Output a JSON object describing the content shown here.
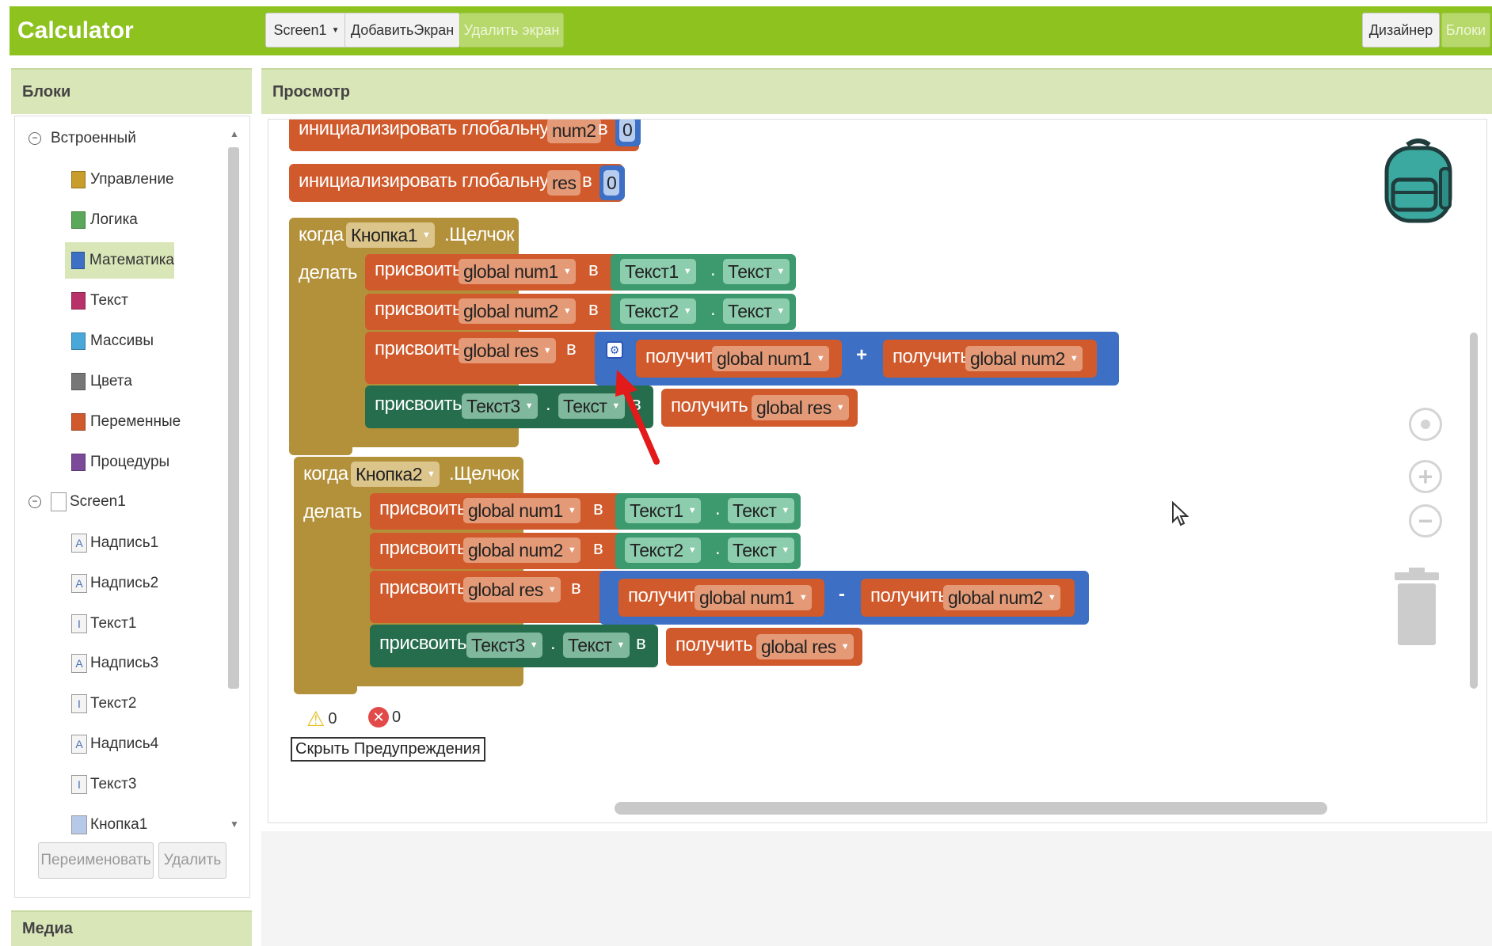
{
  "app": {
    "title": "Calculator"
  },
  "toolbar": {
    "screen_select": "Screen1",
    "add_screen": "ДобавитьЭкран",
    "remove_screen": "Удалить экран",
    "designer": "Дизайнер",
    "blocks": "Блоки"
  },
  "left_panel": {
    "header": "Блоки",
    "builtin_label": "Встроенный",
    "builtin_items": [
      {
        "label": "Управление",
        "color": "#c89d2c"
      },
      {
        "label": "Логика",
        "color": "#5ba85a"
      },
      {
        "label": "Математика",
        "color": "#3d6fc4"
      },
      {
        "label": "Текст",
        "color": "#b8326a"
      },
      {
        "label": "Массивы",
        "color": "#4aa8d8"
      },
      {
        "label": "Цвета",
        "color": "#777777"
      },
      {
        "label": "Переменные",
        "color": "#d05a2c"
      },
      {
        "label": "Процедуры",
        "color": "#7b4a98"
      }
    ],
    "screen_label": "Screen1",
    "components": [
      {
        "label": "Надпись1",
        "icon": "A"
      },
      {
        "label": "Надпись2",
        "icon": "A"
      },
      {
        "label": "Текст1",
        "icon": "I"
      },
      {
        "label": "Надпись3",
        "icon": "A"
      },
      {
        "label": "Текст2",
        "icon": "I"
      },
      {
        "label": "Надпись4",
        "icon": "A"
      },
      {
        "label": "Текст3",
        "icon": "I"
      },
      {
        "label": "Кнопка1",
        "icon": ""
      }
    ],
    "rename_button": "Переименовать",
    "delete_button": "Удалить",
    "media_header": "Медиа"
  },
  "viewer": {
    "header": "Просмотр",
    "init_blocks": [
      {
        "text": "инициализировать глобальную",
        "var": "num2",
        "in": "в",
        "value": "0"
      },
      {
        "text": "инициализировать глобальную",
        "var": "res",
        "in": "в",
        "value": "0"
      }
    ],
    "event1": {
      "when": "когда",
      "component": "Кнопка1",
      "event": ".Щелчок",
      "do": "делать",
      "set": "присвоить",
      "in": "в",
      "get": "получить",
      "dot": ".",
      "row1": {
        "var": "global num1",
        "comp": "Текст1",
        "prop": "Текст"
      },
      "row2": {
        "var": "global num2",
        "comp": "Текст2",
        "prop": "Текст"
      },
      "row3": {
        "var": "global res",
        "left": "global num1",
        "op": "+",
        "right": "global num2"
      },
      "row4": {
        "comp": "Текст3",
        "prop": "Текст",
        "var": "global res"
      }
    },
    "event2": {
      "when": "когда",
      "component": "Кнопка2",
      "event": ".Щелчок",
      "do": "делать",
      "set": "присвоить",
      "in": "в",
      "get": "получить",
      "dot": ".",
      "row1": {
        "var": "global num1",
        "comp": "Текст1",
        "prop": "Текст"
      },
      "row2": {
        "var": "global num2",
        "comp": "Текст2",
        "prop": "Текст"
      },
      "row3": {
        "var": "global res",
        "left": "global num1",
        "op": "-",
        "right": "global num2"
      },
      "row4": {
        "comp": "Текст3",
        "prop": "Текст",
        "var": "global res"
      }
    },
    "warnings_count": "0",
    "errors_count": "0",
    "hide_warnings": "Скрыть Предупреждения"
  }
}
